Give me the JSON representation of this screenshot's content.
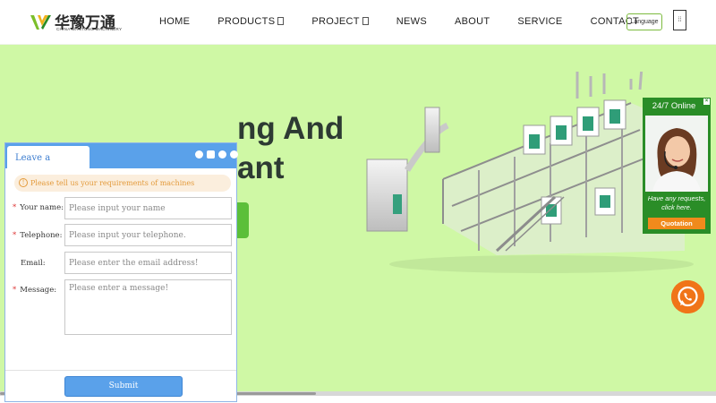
{
  "header": {
    "logo_cn": "华豫万通",
    "logo_en": "CHINA WANTONG MACHINERY",
    "nav": [
      {
        "label": "HOME",
        "dropdown": false
      },
      {
        "label": "PRODUCTS",
        "dropdown": true
      },
      {
        "label": "PROJECT",
        "dropdown": true
      },
      {
        "label": "NEWS",
        "dropdown": false
      },
      {
        "label": "ABOUT",
        "dropdown": false
      },
      {
        "label": "SERVICE",
        "dropdown": false
      },
      {
        "label": "CONTACT",
        "dropdown": false
      }
    ],
    "language_label": "Language",
    "menu_icon": "menu-icon"
  },
  "hero": {
    "title_line1": "ng And",
    "title_line2": "ant",
    "background": "#cff8a5"
  },
  "message_panel": {
    "tab_label": "Leave a message",
    "notice": "Please tell us your requirements of machines",
    "fields": {
      "name": {
        "label": "Your name:",
        "required": true,
        "placeholder": "Please input your name"
      },
      "phone": {
        "label": "Telephone:",
        "required": true,
        "placeholder": "Please input your telephone."
      },
      "email": {
        "label": "Email:",
        "required": false,
        "placeholder": "Please enter the email address!"
      },
      "message": {
        "label": "Message:",
        "required": true,
        "placeholder": "Please enter a message!"
      }
    },
    "submit_label": "Submit",
    "accent": "#5aa1ea"
  },
  "online_widget": {
    "title": "24/7 Online",
    "text_line1": "Have any requests,",
    "text_line2": "click here.",
    "button_label": "Quotation",
    "accent": "#2a8d27",
    "button_color": "#f08a1c"
  },
  "whatsapp": {
    "icon": "whatsapp-icon",
    "color": "#f07418"
  }
}
